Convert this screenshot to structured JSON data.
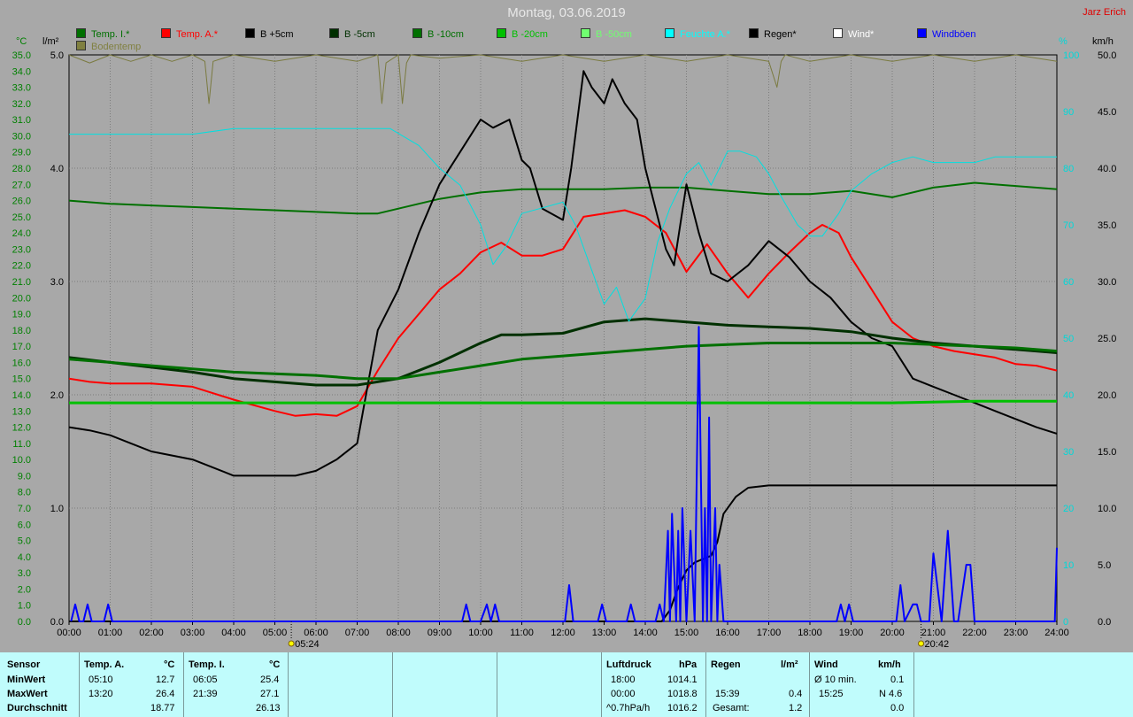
{
  "page": {
    "title": "Montag, 03.06.2019",
    "author": "Jarz Erich"
  },
  "axes": {
    "left_temp_unit": "°C",
    "left_rain_unit": "l/m²",
    "right_pct_unit": "%",
    "right_wind_unit": "km/h"
  },
  "legend": [
    {
      "label": "Temp. I.*",
      "color": "#007000"
    },
    {
      "label": "Temp. A.*",
      "color": "#ff0000"
    },
    {
      "label": "B +5cm",
      "color": "#000000"
    },
    {
      "label": "B -5cm",
      "color": "#003000"
    },
    {
      "label": "B -10cm",
      "color": "#007000"
    },
    {
      "label": "B -20cm",
      "color": "#00c000"
    },
    {
      "label": "B -50cm",
      "color": "#70ff70"
    },
    {
      "label": "Feuchte A.*",
      "color": "#00ffff"
    },
    {
      "label": "Regen*",
      "color": "#000000"
    },
    {
      "label": "Wind*",
      "color": "#ffffff"
    },
    {
      "label": "Windböen",
      "color": "#0000ff"
    },
    {
      "label": "Bodentemp",
      "color": "#808040"
    }
  ],
  "sun": {
    "rise": "05:24",
    "set": "20:42"
  },
  "chart_data": {
    "type": "line",
    "x_unit": "hours",
    "xlim": [
      0,
      24
    ],
    "x_ticks": [
      "00:00",
      "01:00",
      "02:00",
      "03:00",
      "04:00",
      "05:00",
      "06:00",
      "07:00",
      "08:00",
      "09:00",
      "10:00",
      "11:00",
      "12:00",
      "13:00",
      "14:00",
      "15:00",
      "16:00",
      "17:00",
      "18:00",
      "19:00",
      "20:00",
      "21:00",
      "22:00",
      "23:00",
      "24:00"
    ],
    "temp_axis": {
      "ylim": [
        0,
        35
      ],
      "ticks": [
        "0.0",
        "1.0",
        "2.0",
        "3.0",
        "4.0",
        "5.0",
        "6.0",
        "7.0",
        "8.0",
        "9.0",
        "10.0",
        "11.0",
        "12.0",
        "13.0",
        "14.0",
        "15.0",
        "16.0",
        "17.0",
        "18.0",
        "19.0",
        "20.0",
        "21.0",
        "22.0",
        "23.0",
        "24.0",
        "25.0",
        "26.0",
        "27.0",
        "28.0",
        "29.0",
        "30.0",
        "31.0",
        "32.0",
        "33.0",
        "34.0",
        "35.0"
      ]
    },
    "rain_axis": {
      "ylim": [
        0,
        5
      ],
      "ticks": [
        "0.0",
        "1.0",
        "2.0",
        "3.0",
        "4.0",
        "5.0"
      ]
    },
    "pct_axis": {
      "ylim": [
        0,
        100
      ],
      "ticks": [
        "0",
        "10",
        "20",
        "30",
        "40",
        "50",
        "60",
        "70",
        "80",
        "90",
        "100"
      ]
    },
    "wind_axis": {
      "ylim": [
        0,
        50
      ],
      "ticks": [
        "0.0",
        "5.0",
        "10.0",
        "15.0",
        "20.0",
        "25.0",
        "30.0",
        "35.0",
        "40.0",
        "45.0",
        "50.0"
      ]
    },
    "series": [
      {
        "name": "Temp. I.*",
        "axis": "temp",
        "color": "#007000",
        "width": 2,
        "x": [
          0,
          1,
          2,
          3,
          4,
          5,
          6,
          7,
          7.5,
          8,
          9,
          10,
          11,
          12,
          13,
          14,
          15,
          16,
          17,
          18,
          19,
          20,
          21,
          22,
          23,
          24
        ],
        "y": [
          26.0,
          25.8,
          25.7,
          25.6,
          25.5,
          25.4,
          25.3,
          25.2,
          25.2,
          25.5,
          26.1,
          26.5,
          26.7,
          26.7,
          26.7,
          26.8,
          26.8,
          26.6,
          26.4,
          26.4,
          26.6,
          26.2,
          26.8,
          27.1,
          26.9,
          26.7
        ]
      },
      {
        "name": "Temp. A.*",
        "axis": "temp",
        "color": "#ff0000",
        "width": 2,
        "x": [
          0,
          0.5,
          1,
          2,
          3,
          4,
          5,
          5.5,
          6,
          6.5,
          7,
          7.5,
          8,
          8.5,
          9,
          9.5,
          10,
          10.5,
          11,
          11.5,
          12,
          12.5,
          13,
          13.5,
          14,
          14.5,
          15,
          15.5,
          16,
          16.5,
          17,
          17.5,
          18,
          18.3,
          18.7,
          19,
          19.5,
          20,
          20.5,
          21,
          21.5,
          22,
          22.5,
          23,
          23.5,
          24
        ],
        "y": [
          15.0,
          14.8,
          14.7,
          14.7,
          14.5,
          13.7,
          13.0,
          12.7,
          12.8,
          12.7,
          13.3,
          15.5,
          17.5,
          19.0,
          20.5,
          21.5,
          22.8,
          23.4,
          22.6,
          22.6,
          23.0,
          25.0,
          25.2,
          25.4,
          25.0,
          24.0,
          21.6,
          23.3,
          21.5,
          20.0,
          21.5,
          22.8,
          24.0,
          24.5,
          24.0,
          22.5,
          20.5,
          18.5,
          17.5,
          17.0,
          16.7,
          16.5,
          16.3,
          15.9,
          15.8,
          15.5
        ]
      },
      {
        "name": "B +5cm",
        "axis": "temp",
        "color": "#000000",
        "width": 2,
        "x": [
          0,
          0.5,
          1,
          2,
          3,
          4,
          4.5,
          5,
          5.5,
          6,
          6.5,
          7,
          7.5,
          8,
          8.5,
          9,
          9.5,
          10,
          10.3,
          10.7,
          11,
          11.2,
          11.5,
          12,
          12.2,
          12.5,
          12.7,
          13,
          13.2,
          13.5,
          13.8,
          14,
          14.2,
          14.5,
          14.7,
          15,
          15.3,
          15.6,
          16,
          16.5,
          17,
          17.5,
          18,
          18.5,
          19,
          19.5,
          20,
          20.5,
          21,
          21.5,
          22,
          22.5,
          23,
          23.5,
          24
        ],
        "y": [
          12.0,
          11.8,
          11.5,
          10.5,
          10.0,
          9.0,
          9.0,
          9.0,
          9.0,
          9.3,
          10.0,
          11.0,
          18.0,
          20.5,
          24.0,
          27.0,
          29.0,
          31.0,
          30.5,
          31.0,
          28.5,
          28.0,
          25.5,
          24.8,
          28.0,
          34.0,
          33.0,
          32.0,
          33.5,
          32.0,
          31.0,
          28.0,
          26.0,
          23.0,
          22.0,
          27.0,
          24.0,
          21.5,
          21.0,
          22.0,
          23.5,
          22.5,
          21.0,
          20.0,
          18.5,
          17.5,
          17.0,
          15.0,
          14.5,
          14.0,
          13.5,
          13.0,
          12.5,
          12.0,
          11.6
        ]
      },
      {
        "name": "B -5cm",
        "axis": "temp",
        "color": "#003000",
        "width": 3,
        "x": [
          0,
          1,
          2,
          3,
          4,
          5,
          6,
          7,
          8,
          9,
          10,
          10.5,
          11,
          12,
          13,
          14,
          15,
          16,
          17,
          18,
          19,
          20,
          21,
          22,
          23,
          24
        ],
        "y": [
          16.3,
          16.0,
          15.7,
          15.4,
          15.0,
          14.8,
          14.6,
          14.6,
          15.0,
          16.0,
          17.2,
          17.7,
          17.7,
          17.8,
          18.5,
          18.7,
          18.5,
          18.3,
          18.2,
          18.1,
          17.9,
          17.5,
          17.2,
          17.0,
          16.8,
          16.6
        ]
      },
      {
        "name": "B -10cm",
        "axis": "temp",
        "color": "#007000",
        "width": 3,
        "x": [
          0,
          1,
          2,
          3,
          4,
          5,
          6,
          7,
          8,
          9,
          10,
          11,
          12,
          13,
          14,
          15,
          16,
          17,
          18,
          19,
          20,
          21,
          22,
          23,
          24
        ],
        "y": [
          16.2,
          16.0,
          15.8,
          15.6,
          15.4,
          15.3,
          15.2,
          15.0,
          15.0,
          15.4,
          15.8,
          16.2,
          16.4,
          16.6,
          16.8,
          17.0,
          17.1,
          17.2,
          17.2,
          17.2,
          17.2,
          17.1,
          17.0,
          16.9,
          16.7
        ]
      },
      {
        "name": "B -20cm",
        "axis": "temp",
        "color": "#00c000",
        "width": 3,
        "x": [
          0,
          2,
          4,
          6,
          8,
          10,
          12,
          14,
          16,
          18,
          20,
          22,
          24
        ],
        "y": [
          13.5,
          13.5,
          13.5,
          13.5,
          13.5,
          13.5,
          13.5,
          13.5,
          13.5,
          13.5,
          13.5,
          13.6,
          13.6
        ]
      },
      {
        "name": "Feuchte A.*",
        "axis": "pct",
        "color": "#00e0e0",
        "width": 1,
        "x": [
          0,
          1,
          2,
          3,
          4,
          5,
          6,
          7,
          7.8,
          8.5,
          9,
          9.5,
          10,
          10.3,
          10.6,
          11,
          11.5,
          12,
          12.3,
          12.7,
          13,
          13.3,
          13.6,
          14,
          14.3,
          14.6,
          15,
          15.3,
          15.6,
          16,
          16.3,
          16.7,
          17,
          17.3,
          17.7,
          18,
          18.3,
          18.7,
          19,
          19.5,
          20,
          20.5,
          21,
          21.5,
          22,
          22.5,
          23,
          23.5,
          24
        ],
        "y": [
          86,
          86,
          86,
          86,
          87,
          87,
          87,
          87,
          87,
          84,
          80,
          77,
          70,
          63,
          66,
          72,
          73,
          74,
          70,
          62,
          56,
          59,
          53,
          57,
          67,
          73,
          79,
          81,
          77,
          83,
          83,
          82,
          79,
          75,
          70,
          68,
          68,
          72,
          76,
          79,
          81,
          82,
          81,
          81,
          81,
          82,
          82,
          82,
          82
        ]
      },
      {
        "name": "Bodentemp",
        "axis": "temp",
        "color": "#7a7a40",
        "width": 1,
        "x": [
          0,
          0.5,
          1,
          1.5,
          2,
          2.5,
          3,
          3.3,
          3.4,
          3.5,
          4,
          5,
          6,
          7,
          7.5,
          7.6,
          7.7,
          8,
          8.1,
          8.2,
          8.3,
          9,
          10,
          11,
          12,
          13,
          14,
          15,
          16,
          17,
          17.2,
          17.3,
          17.4,
          18,
          19,
          20,
          21,
          22,
          23,
          24
        ],
        "y": [
          35,
          34.5,
          35,
          34.6,
          35,
          34.6,
          35,
          34.6,
          32,
          34.6,
          35,
          34.6,
          35,
          34.6,
          35,
          32,
          34.5,
          35,
          32,
          34.5,
          35,
          34.8,
          35,
          34.6,
          35,
          34.6,
          35,
          34.6,
          35,
          34.6,
          33,
          34.6,
          35,
          34.6,
          35,
          34.6,
          35,
          34.6,
          35,
          34.6
        ]
      },
      {
        "name": "Regen*",
        "axis": "rain",
        "color": "#000000",
        "width": 2,
        "x": [
          0,
          14.4,
          14.6,
          14.8,
          15,
          15.2,
          15.4,
          15.6,
          15.75,
          15.9,
          16.2,
          16.5,
          17,
          18,
          19,
          20,
          21,
          22,
          23,
          24
        ],
        "y": [
          0,
          0,
          0.1,
          0.3,
          0.45,
          0.52,
          0.55,
          0.58,
          0.7,
          0.95,
          1.1,
          1.18,
          1.2,
          1.2,
          1.2,
          1.2,
          1.2,
          1.2,
          1.2,
          1.2
        ]
      },
      {
        "name": "Windböen",
        "axis": "wind",
        "color": "#0000ff",
        "width": 2,
        "x": [
          0.05,
          0.15,
          0.25,
          0.35,
          0.45,
          0.55,
          0.65,
          0.85,
          0.95,
          1.05,
          9.55,
          9.65,
          9.75,
          10.0,
          10.15,
          10.25,
          10.35,
          10.45,
          12.05,
          12.15,
          12.25,
          12.85,
          12.95,
          13.05,
          13.55,
          13.65,
          13.75,
          14.25,
          14.35,
          14.45,
          14.55,
          14.6,
          14.65,
          14.75,
          14.8,
          14.85,
          14.9,
          15.0,
          15.1,
          15.2,
          15.3,
          15.4,
          15.45,
          15.5,
          15.55,
          15.6,
          15.7,
          15.75,
          15.8,
          15.9,
          16.0,
          16.1,
          18.65,
          18.75,
          18.85,
          18.95,
          19.05,
          20.1,
          20.2,
          20.3,
          20.5,
          20.6,
          20.7,
          20.9,
          21.0,
          21.2,
          21.35,
          21.5,
          21.6,
          21.8,
          21.9,
          22.0,
          23.95,
          24.0
        ],
        "y": [
          0,
          1.5,
          0,
          0,
          1.5,
          0,
          0,
          0,
          1.5,
          0,
          0,
          1.5,
          0,
          0,
          1.5,
          0,
          1.5,
          0,
          0,
          3.2,
          0,
          0,
          1.5,
          0,
          0,
          1.5,
          0,
          0,
          1.5,
          0,
          8,
          0,
          9.5,
          0,
          8,
          0,
          10,
          0,
          8,
          0,
          26,
          0,
          10,
          0,
          18,
          0,
          10,
          0,
          5,
          0,
          0,
          0,
          0,
          1.5,
          0,
          1.5,
          0,
          0,
          3.2,
          0,
          1.5,
          1.5,
          0,
          0,
          6,
          0,
          8,
          0,
          0,
          5,
          5,
          0,
          0,
          6.5
        ]
      }
    ]
  },
  "summary": {
    "sensor_header": "Sensor",
    "row_labels": [
      "MinWert",
      "MaxWert",
      "Durchschnitt"
    ],
    "temp_a": {
      "header": "Temp. A.",
      "unit": "°C",
      "rows": [
        {
          "time": "05:10",
          "value": "12.7"
        },
        {
          "time": "13:20",
          "value": "26.4"
        },
        {
          "time": "",
          "value": "18.77"
        }
      ]
    },
    "temp_i": {
      "header": "Temp. I.",
      "unit": "°C",
      "rows": [
        {
          "time": "06:05",
          "value": "25.4"
        },
        {
          "time": "21:39",
          "value": "27.1"
        },
        {
          "time": "",
          "value": "26.13"
        }
      ]
    },
    "luftdruck": {
      "header": "Luftdruck",
      "unit": "hPa",
      "rows": [
        {
          "time": "18:00",
          "value": "1014.1"
        },
        {
          "time": "00:00",
          "value": "1018.8"
        },
        {
          "time": "^0.7hPa/h",
          "value": "1016.2"
        }
      ]
    },
    "regen": {
      "header": "Regen",
      "unit": "l/m²",
      "rows": [
        {
          "time": "",
          "value": ""
        },
        {
          "time": "15:39",
          "value": "0.4"
        },
        {
          "time": "Gesamt:",
          "value": "1.2"
        }
      ]
    },
    "wind": {
      "header": "Wind",
      "unit": "km/h",
      "rows": [
        {
          "time": "Ø 10 min.",
          "value": "0.1"
        },
        {
          "time": "15:25",
          "value": "N 4.6"
        },
        {
          "time": "",
          "value": "0.0"
        }
      ]
    }
  }
}
